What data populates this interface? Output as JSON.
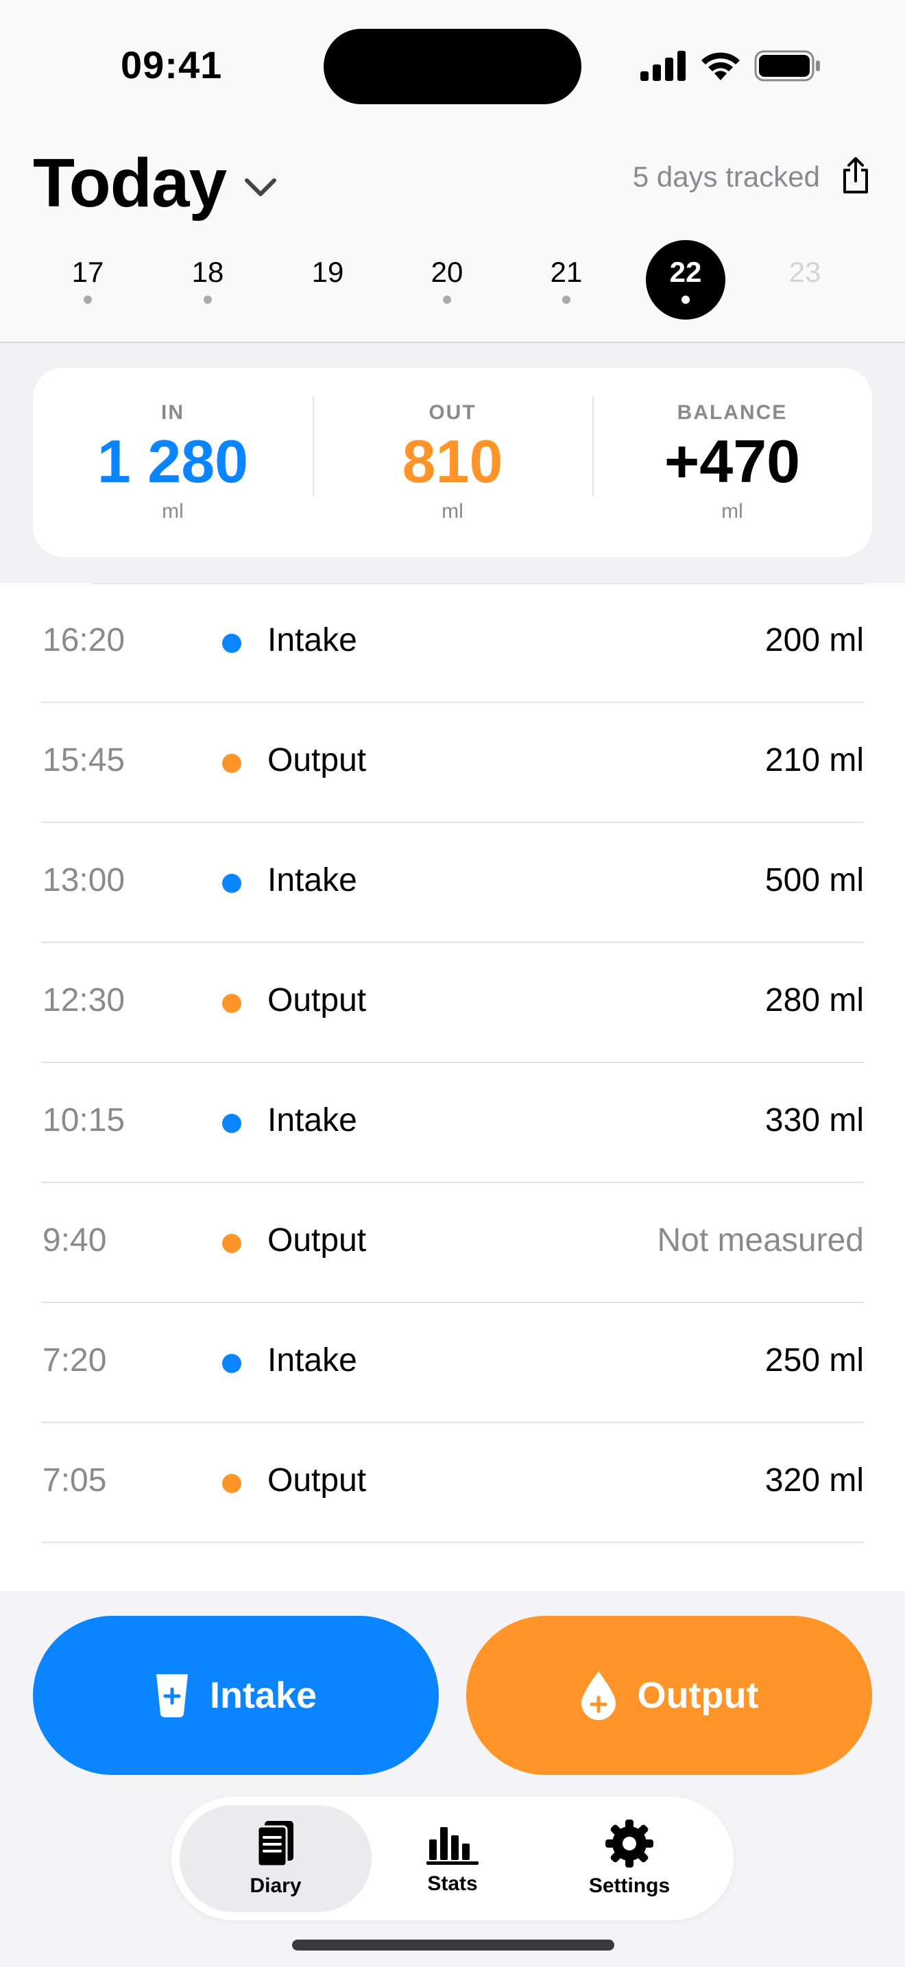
{
  "status_bar": {
    "time": "09:41"
  },
  "header": {
    "title": "Today",
    "tracked_text": "5 days tracked",
    "days": [
      {
        "label": "17",
        "state": "past"
      },
      {
        "label": "18",
        "state": "past"
      },
      {
        "label": "19",
        "state": "empty"
      },
      {
        "label": "20",
        "state": "past"
      },
      {
        "label": "21",
        "state": "past"
      },
      {
        "label": "22",
        "state": "selected"
      },
      {
        "label": "23",
        "state": "future"
      }
    ]
  },
  "summary": {
    "in": {
      "label": "IN",
      "value": "1 280",
      "unit": "ml",
      "color": "#0a84ff"
    },
    "out": {
      "label": "OUT",
      "value": "810",
      "unit": "ml",
      "color": "#ff9428"
    },
    "balance": {
      "label": "BALANCE",
      "value": "+470",
      "unit": "ml",
      "color": "#000000"
    }
  },
  "entries": [
    {
      "time": "16:20",
      "type": "Intake",
      "amount": "200 ml",
      "kind": "intake"
    },
    {
      "time": "15:45",
      "type": "Output",
      "amount": "210 ml",
      "kind": "output"
    },
    {
      "time": "13:00",
      "type": "Intake",
      "amount": "500 ml",
      "kind": "intake"
    },
    {
      "time": "12:30",
      "type": "Output",
      "amount": "280 ml",
      "kind": "output"
    },
    {
      "time": "10:15",
      "type": "Intake",
      "amount": "330 ml",
      "kind": "intake"
    },
    {
      "time": "9:40",
      "type": "Output",
      "amount": "Not measured",
      "kind": "output",
      "muted": true
    },
    {
      "time": "7:20",
      "type": "Intake",
      "amount": "250 ml",
      "kind": "intake"
    },
    {
      "time": "7:05",
      "type": "Output",
      "amount": "320 ml",
      "kind": "output"
    }
  ],
  "colors": {
    "intake": "#0a84ff",
    "output": "#ff9428"
  },
  "actions": {
    "intake_label": "Intake",
    "output_label": "Output"
  },
  "tabs": [
    {
      "label": "Diary",
      "icon": "diary-icon",
      "active": true
    },
    {
      "label": "Stats",
      "icon": "bar-chart-icon",
      "active": false
    },
    {
      "label": "Settings",
      "icon": "gear-icon",
      "active": false
    }
  ]
}
